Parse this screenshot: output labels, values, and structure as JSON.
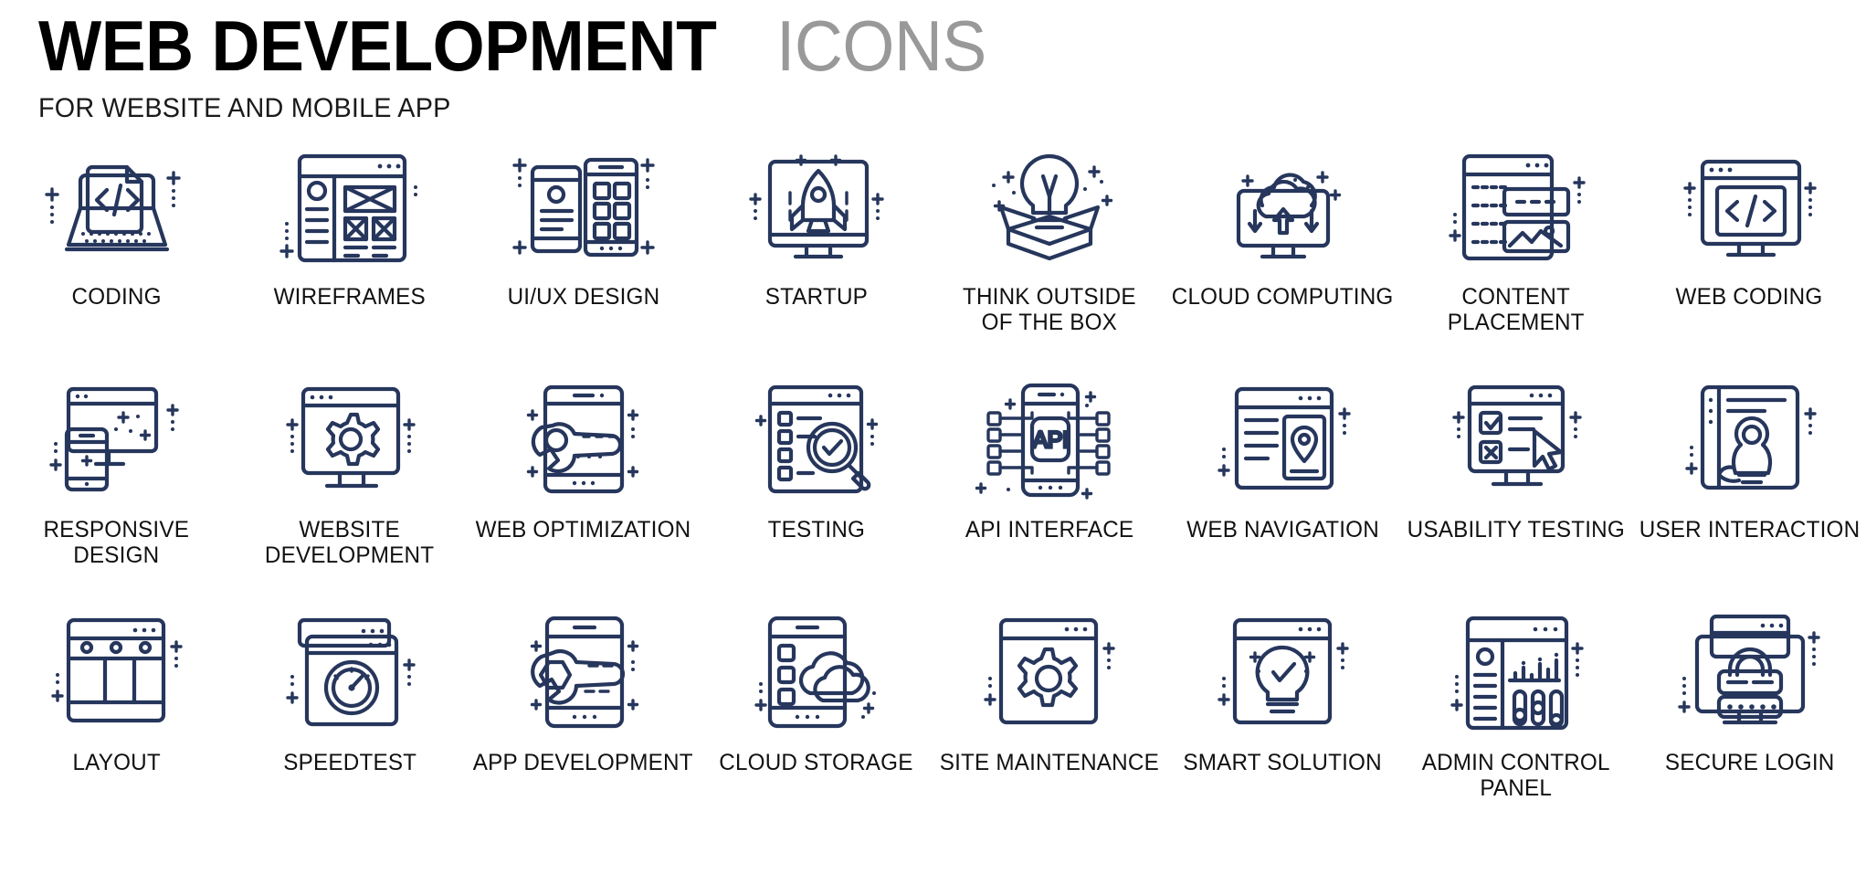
{
  "header": {
    "title_main": "WEB DEVELOPMENT",
    "title_accent": "ICONS",
    "subtitle": "FOR WEBSITE AND MOBILE APP"
  },
  "theme": {
    "icon_color": "#26365c",
    "title_color": "#000000",
    "accent_color": "#999999",
    "background": "#ffffff",
    "label_color": "#111111"
  },
  "grid": {
    "columns": 8,
    "rows": 3,
    "items": [
      {
        "label": "CODING",
        "icon": "laptop-code-icon"
      },
      {
        "label": "WIREFRAMES",
        "icon": "wireframe-layout-icon"
      },
      {
        "label": "UI/UX DESIGN",
        "icon": "mobile-panels-icon"
      },
      {
        "label": "STARTUP",
        "icon": "rocket-monitor-icon"
      },
      {
        "label": "THINK OUTSIDE\nOF THE BOX",
        "icon": "lightbulb-box-icon"
      },
      {
        "label": "CLOUD COMPUTING",
        "icon": "cloud-arrows-monitor-icon"
      },
      {
        "label": "CONTENT PLACEMENT",
        "icon": "content-blocks-icon"
      },
      {
        "label": "WEB CODING",
        "icon": "monitor-code-icon"
      },
      {
        "label": "RESPONSIVE\nDESIGN",
        "icon": "monitor-phone-icon"
      },
      {
        "label": "WEBSITE\nDEVELOPMENT",
        "icon": "monitor-gear-icon"
      },
      {
        "label": "WEB OPTIMIZATION",
        "icon": "wrench-phone-icon"
      },
      {
        "label": "TESTING",
        "icon": "checklist-magnifier-icon"
      },
      {
        "label": "API INTERFACE",
        "icon": "api-phone-icon"
      },
      {
        "label": "WEB NAVIGATION",
        "icon": "browser-pin-icon"
      },
      {
        "label": "USABILITY TESTING",
        "icon": "monitor-cursor-check-icon"
      },
      {
        "label": "USER INTERACTION",
        "icon": "tablet-hand-touch-icon"
      },
      {
        "label": "LAYOUT",
        "icon": "layout-grid-icon"
      },
      {
        "label": "SPEEDTEST",
        "icon": "browser-gauge-icon"
      },
      {
        "label": "APP DEVELOPMENT",
        "icon": "wrench-mobile-icon"
      },
      {
        "label": "CLOUD STORAGE",
        "icon": "mobile-cloud-icon"
      },
      {
        "label": "SITE MAINTENANCE",
        "icon": "browser-gear-icon"
      },
      {
        "label": "SMART SOLUTION",
        "icon": "bulb-check-browser-icon"
      },
      {
        "label": "ADMIN CONTROL PANEL",
        "icon": "dashboard-sliders-icon"
      },
      {
        "label": "SECURE LOGIN",
        "icon": "monitor-lock-icon"
      }
    ]
  }
}
